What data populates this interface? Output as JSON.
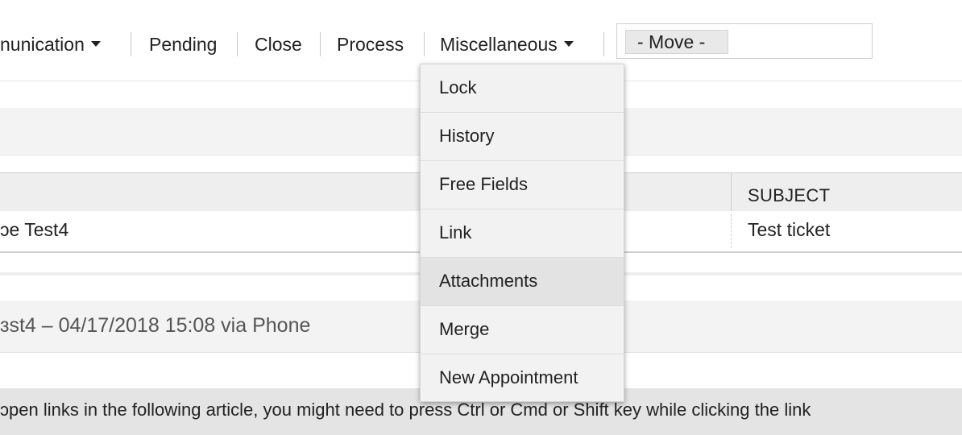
{
  "toolbar": {
    "items": [
      {
        "label": "nunication",
        "has_caret": true
      },
      {
        "label": "Pending",
        "has_caret": false
      },
      {
        "label": "Close",
        "has_caret": false
      },
      {
        "label": "Process",
        "has_caret": false
      },
      {
        "label": "Miscellaneous",
        "has_caret": true
      }
    ],
    "move_select_value": "- Move -"
  },
  "menu": {
    "items": [
      "Lock",
      "History",
      "Free Fields",
      "Link",
      "Attachments",
      "Merge",
      "New Appointment"
    ],
    "highlighted": "Attachments"
  },
  "table": {
    "header_subject": "SUBJECT",
    "row": {
      "from": "ɔe Test4",
      "subject": "Test ticket"
    }
  },
  "article": {
    "title": "ɜst4 – 04/17/2018 15:08 via Phone"
  },
  "notice": {
    "text": "ɔpen links in the following article, you might need to press Ctrl or Cmd or Shift key while clicking the link"
  }
}
